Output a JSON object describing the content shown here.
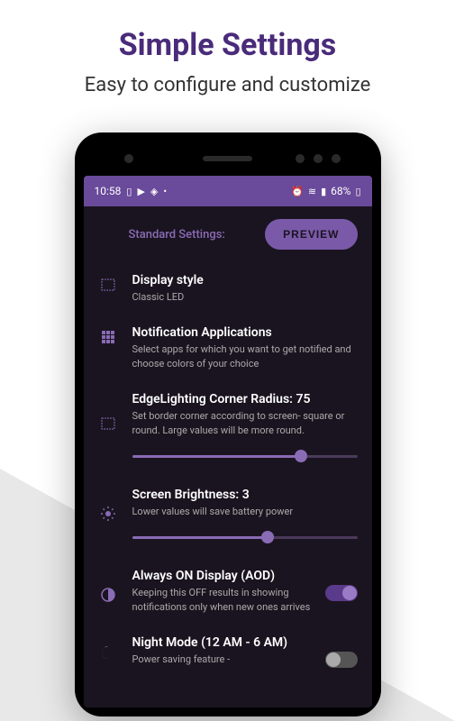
{
  "header": {
    "title": "Simple Settings",
    "subtitle": "Easy to configure and customize"
  },
  "statusBar": {
    "time": "10:58",
    "battery": "68%"
  },
  "settings": {
    "sectionLabel": "Standard Settings:",
    "previewButton": "PREVIEW",
    "items": {
      "displayStyle": {
        "title": "Display style",
        "desc": "Classic LED"
      },
      "notificationApps": {
        "title": "Notification Applications",
        "desc": "Select apps for which you want to get notified and choose colors of your choice"
      },
      "edgeLighting": {
        "title": "EdgeLighting Corner Radius: 75",
        "desc": "Set border corner according to screen- square or round. Large values will be more round.",
        "value": 75
      },
      "brightness": {
        "title": "Screen Brightness: 3",
        "desc": "Lower values will save battery power",
        "value": 60
      },
      "aod": {
        "title": "Always ON Display (AOD)",
        "desc": "Keeping this OFF results in showing notifications only when new ones arrives"
      },
      "nightMode": {
        "title": "Night Mode (12 AM - 6 AM)",
        "desc": "Power saving feature -"
      }
    }
  }
}
